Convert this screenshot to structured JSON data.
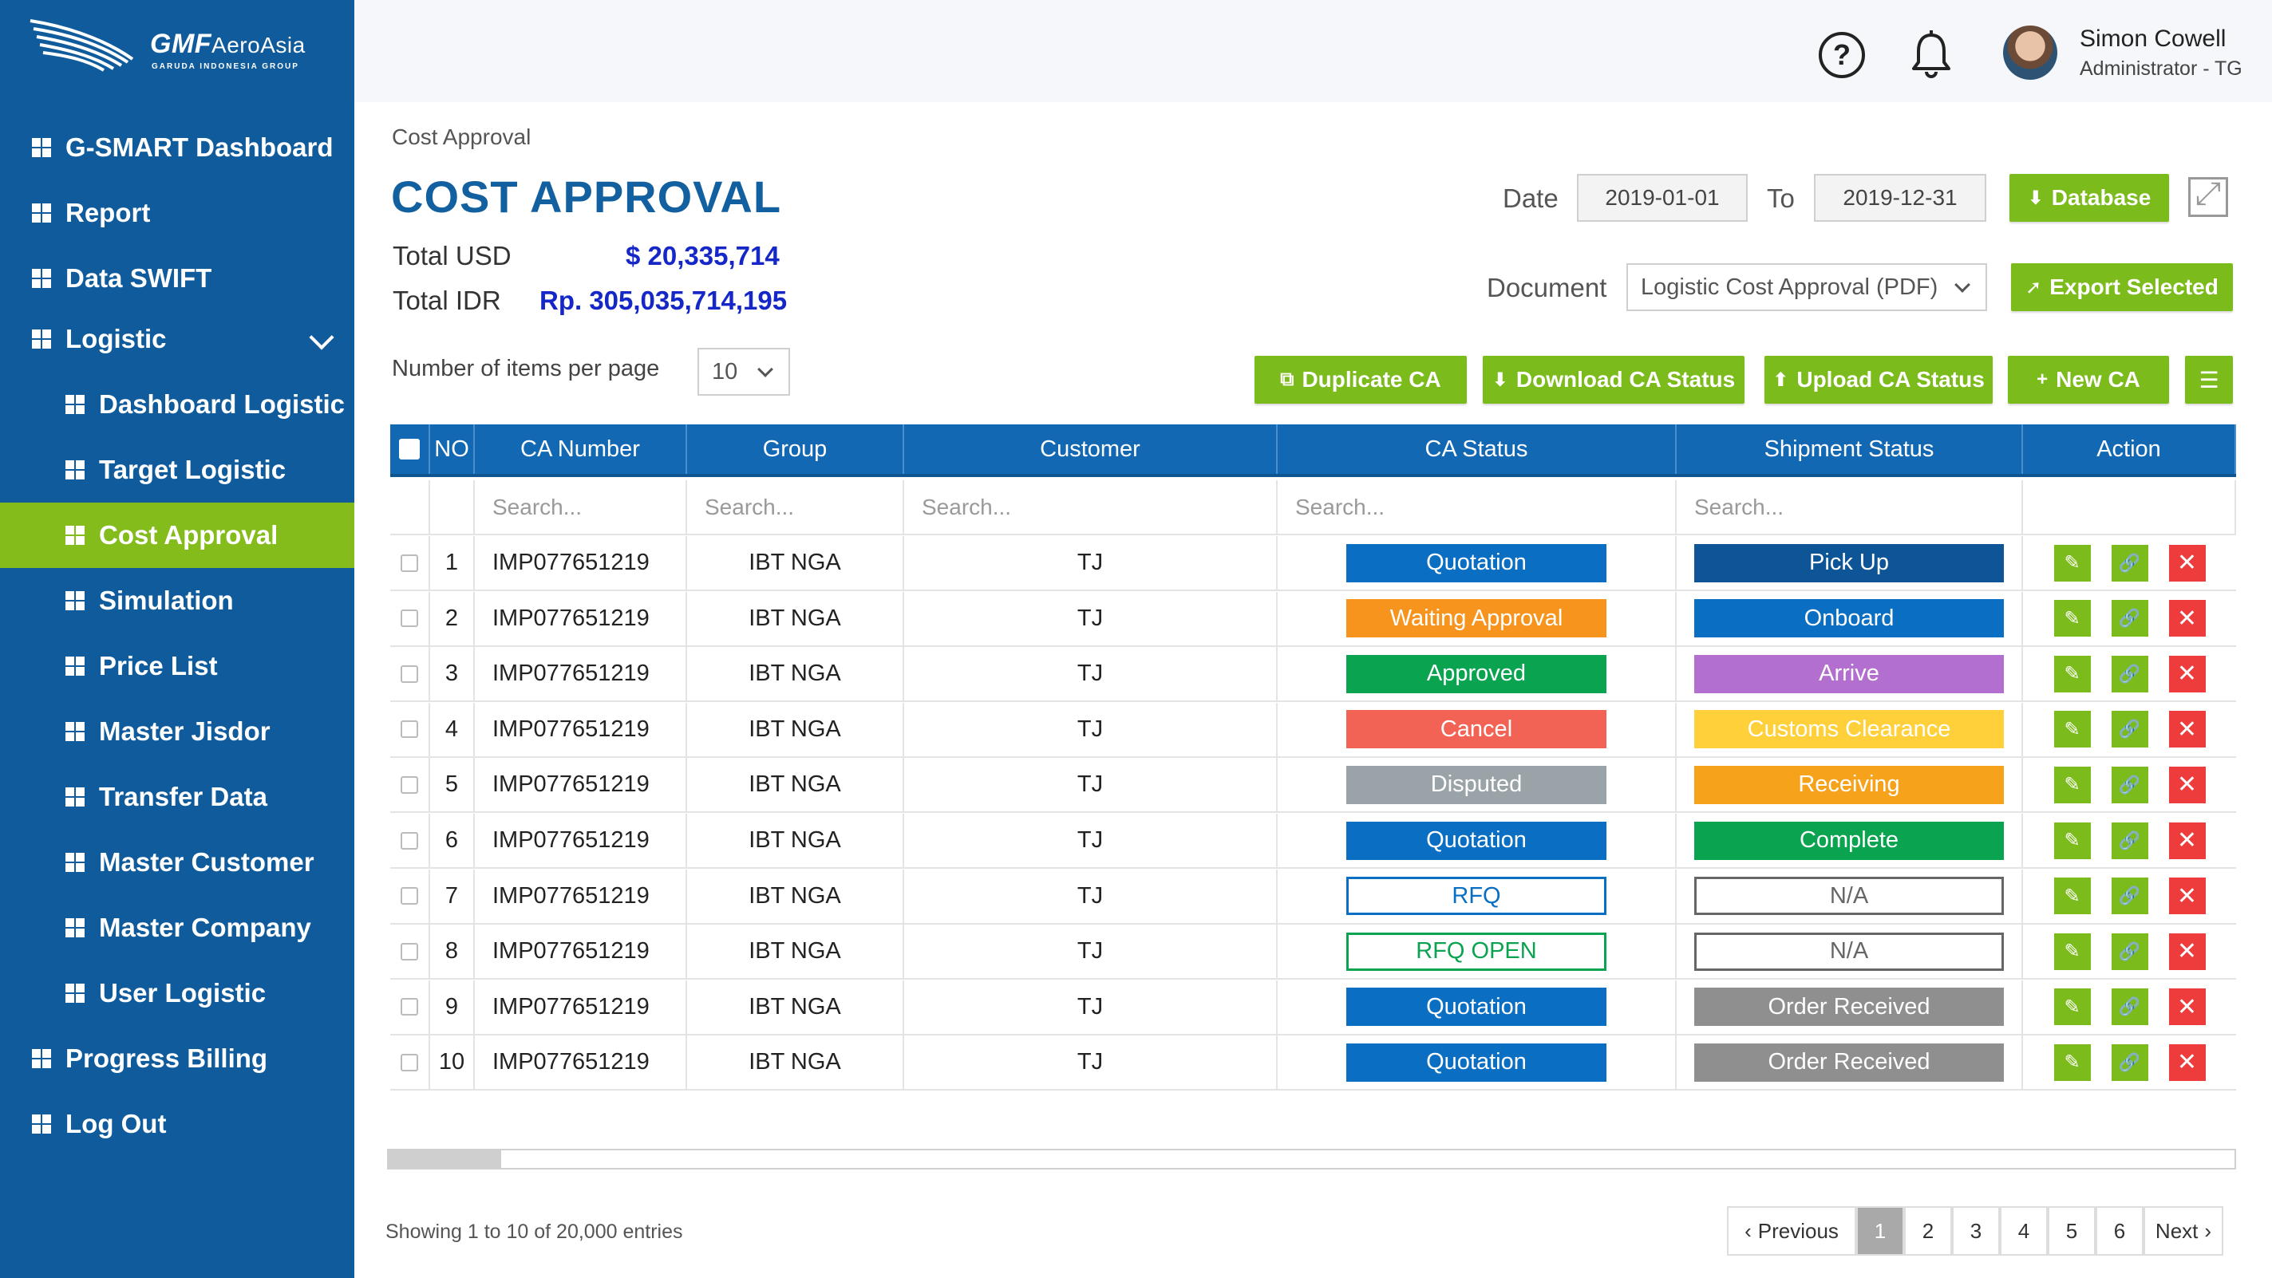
{
  "logo": {
    "brand": "GMF",
    "brand_suffix": "AeroAsia",
    "sub": "GARUDA INDONESIA GROUP"
  },
  "sidebar": {
    "items": [
      {
        "label": "G-SMART Dashboard",
        "level": "top"
      },
      {
        "label": "Report",
        "level": "top"
      },
      {
        "label": "Data SWIFT",
        "level": "top"
      },
      {
        "label": "Logistic",
        "level": "top",
        "expanded": true
      },
      {
        "label": "Dashboard Logistic",
        "level": "sub"
      },
      {
        "label": "Target Logistic",
        "level": "sub"
      },
      {
        "label": "Cost Approval",
        "level": "sub",
        "active": true
      },
      {
        "label": "Simulation",
        "level": "sub"
      },
      {
        "label": "Price List",
        "level": "sub"
      },
      {
        "label": "Master Jisdor",
        "level": "sub"
      },
      {
        "label": "Transfer Data",
        "level": "sub"
      },
      {
        "label": "Master Customer",
        "level": "sub"
      },
      {
        "label": "Master Company",
        "level": "sub"
      },
      {
        "label": "User Logistic",
        "level": "sub"
      },
      {
        "label": "Progress Billing",
        "level": "top"
      },
      {
        "label": "Log Out",
        "level": "top"
      }
    ],
    "colors": {
      "background": "#0f5b9c",
      "active": "#84bc1c"
    }
  },
  "header": {
    "help_glyph": "?",
    "user_name": "Simon Cowell",
    "user_role": "Administrator - TG"
  },
  "breadcrumb": "Cost Approval",
  "title": "COST APPROVAL",
  "totals": {
    "usd_label": "Total USD",
    "usd_value": "$ 20,335,714",
    "idr_label": "Total IDR",
    "idr_value": "Rp. 305,035,714,195"
  },
  "filters": {
    "date_label": "Date",
    "date_from": "2019-01-01",
    "to_label": "To",
    "date_to": "2019-12-31",
    "database_button": "Database",
    "document_label": "Document",
    "document_value": "Logistic Cost Approval (PDF)",
    "export_button": "Export Selected"
  },
  "per_page": {
    "label": "Number of items per page",
    "value": "10"
  },
  "toolbar": {
    "duplicate": "Duplicate CA",
    "download": "Download CA Status",
    "upload": "Upload CA Status",
    "new": "New CA"
  },
  "table": {
    "columns": [
      "NO",
      "CA Number",
      "Group",
      "Customer",
      "CA Status",
      "Shipment Status",
      "Action"
    ],
    "search_placeholder": "Search...",
    "rows": [
      {
        "no": "1",
        "ca": "IMP077651219",
        "group": "IBT NGA",
        "customer": "TJ",
        "ca_status": "Quotation",
        "ca_color": "#0a6fc2",
        "ca_outline": false,
        "ship": "Pick Up",
        "ship_color": "#0d5596",
        "ship_outline": false
      },
      {
        "no": "2",
        "ca": "IMP077651219",
        "group": "IBT NGA",
        "customer": "TJ",
        "ca_status": "Waiting Approval",
        "ca_color": "#f7941d",
        "ca_outline": false,
        "ship": "Onboard",
        "ship_color": "#0a6fc2",
        "ship_outline": false
      },
      {
        "no": "3",
        "ca": "IMP077651219",
        "group": "IBT NGA",
        "customer": "TJ",
        "ca_status": "Approved",
        "ca_color": "#0aa34f",
        "ca_outline": false,
        "ship": "Arrive",
        "ship_color": "#b36fcf",
        "ship_outline": false
      },
      {
        "no": "4",
        "ca": "IMP077651219",
        "group": "IBT NGA",
        "customer": "TJ",
        "ca_status": "Cancel",
        "ca_color": "#f26355",
        "ca_outline": false,
        "ship": "Customs Clearance",
        "ship_color": "#ffd03a",
        "ship_outline": false
      },
      {
        "no": "5",
        "ca": "IMP077651219",
        "group": "IBT NGA",
        "customer": "TJ",
        "ca_status": "Disputed",
        "ca_color": "#9aa3a7",
        "ca_outline": false,
        "ship": "Receiving",
        "ship_color": "#f7a21b",
        "ship_outline": false
      },
      {
        "no": "6",
        "ca": "IMP077651219",
        "group": "IBT NGA",
        "customer": "TJ",
        "ca_status": "Quotation",
        "ca_color": "#0a6fc2",
        "ca_outline": false,
        "ship": "Complete",
        "ship_color": "#0aa34f",
        "ship_outline": false
      },
      {
        "no": "7",
        "ca": "IMP077651219",
        "group": "IBT NGA",
        "customer": "TJ",
        "ca_status": "RFQ",
        "ca_color": "#0a6fc2",
        "ca_outline": true,
        "ship": "N/A",
        "ship_color": "#666666",
        "ship_outline": true
      },
      {
        "no": "8",
        "ca": "IMP077651219",
        "group": "IBT NGA",
        "customer": "TJ",
        "ca_status": "RFQ OPEN",
        "ca_color": "#0aa34f",
        "ca_outline": true,
        "ship": "N/A",
        "ship_color": "#666666",
        "ship_outline": true
      },
      {
        "no": "9",
        "ca": "IMP077651219",
        "group": "IBT NGA",
        "customer": "TJ",
        "ca_status": "Quotation",
        "ca_color": "#0a6fc2",
        "ca_outline": false,
        "ship": "Order Received",
        "ship_color": "#8f8f8f",
        "ship_outline": false
      },
      {
        "no": "10",
        "ca": "IMP077651219",
        "group": "IBT NGA",
        "customer": "TJ",
        "ca_status": "Quotation",
        "ca_color": "#0a6fc2",
        "ca_outline": false,
        "ship": "Order Received",
        "ship_color": "#8f8f8f",
        "ship_outline": false
      }
    ]
  },
  "scrollbar": {
    "position_fraction": 0.0,
    "visible_fraction": 0.061
  },
  "footer": {
    "info": "Showing 1 to 10 of 20,000 entries",
    "pagination": [
      "Previous",
      "1",
      "2",
      "3",
      "4",
      "5",
      "6",
      "Next"
    ],
    "current_page": "1"
  },
  "colors": {
    "primary": "#12609f",
    "accent_green": "#7cbb1c",
    "delete_red": "#ee3c3c",
    "header_blue": "#1268b2"
  }
}
